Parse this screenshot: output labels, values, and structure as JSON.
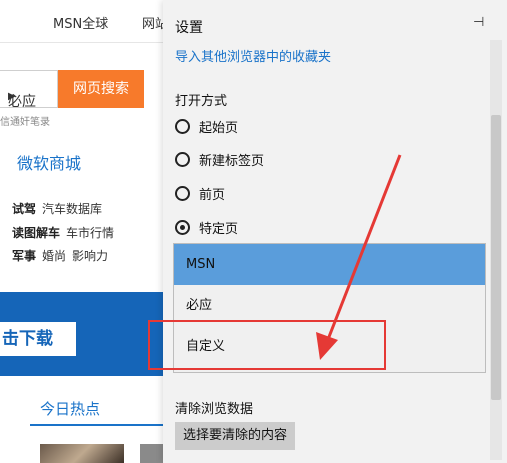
{
  "background_page": {
    "nav": {
      "msn_global": "MSN全球",
      "tab_fragment": "网站"
    },
    "search": {
      "engine": "必应",
      "button": "网页搜索",
      "hint": "信通奸笔录"
    },
    "store": "微软商城",
    "link_rows": [
      {
        "bold": "试驾",
        "items": [
          "汽车数据库"
        ]
      },
      {
        "bold": "读图解车",
        "items": [
          "车市行情"
        ]
      },
      {
        "bold": "军事",
        "items": [
          "婚尚",
          "影响力"
        ]
      }
    ],
    "banner_button": "击下载",
    "hot_tab": "今日热点"
  },
  "settings": {
    "title": "设置",
    "pin_icon": "⊣",
    "import_link": "导入其他浏览器中的收藏夹",
    "open_with_label": "打开方式",
    "open_options": [
      {
        "label": "起始页",
        "selected": false
      },
      {
        "label": "新建标签页",
        "selected": false
      },
      {
        "label": "前页",
        "selected": false
      },
      {
        "label": "特定页",
        "selected": true
      }
    ],
    "dropdown_options": [
      {
        "label": "MSN",
        "selected": true
      },
      {
        "label": "必应",
        "selected": false
      },
      {
        "label": "自定义",
        "selected": false
      }
    ],
    "clear_label": "清除浏览数据",
    "clear_button": "选择要清除的内容"
  },
  "colors": {
    "accent_blue": "#1a73c9",
    "search_orange": "#f77a2b",
    "selected_option": "#5a9ddb",
    "annotation_red": "#e53935"
  }
}
